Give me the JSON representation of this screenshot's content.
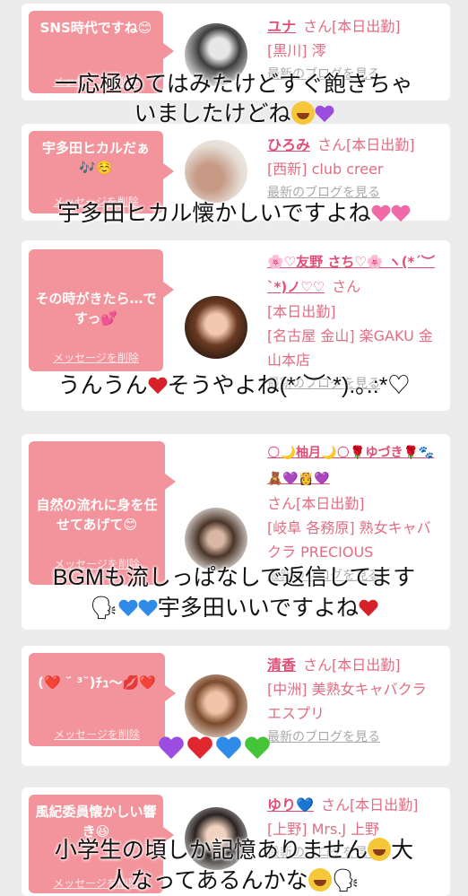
{
  "cards": [
    {
      "bubble_text": "SNS時代ですね😊",
      "delete_label": "メッセージを削除",
      "name": "ユナ",
      "status": "さん[本日出勤]",
      "area": "[黒川] 澪",
      "blog_link": "最新のブログを見る"
    },
    {
      "bubble_text": "宇多田ヒカルだぁ🎶☺️",
      "delete_label": "メッセージを削除",
      "name": "ひろみ",
      "status": "さん[本日出勤]",
      "area": "[西新] club creer",
      "blog_link": "最新のブログを見る"
    },
    {
      "bubble_text": "その時がきたら…ですっ💕",
      "delete_label": "メッセージを削除",
      "name": "🌸♡友野 さち♡🌸 ヽ(*´︶`*)ノ♡♡",
      "status": "さん",
      "status2": "[本日出勤]",
      "area": "[名古屋 金山] 楽GAKU 金山本店",
      "blog_link": "最新のブログを見る"
    },
    {
      "bubble_text": "自然の流れに身を任せてあげて😊",
      "delete_label": "メッセージを削除",
      "name": "🌕🌙柚月🌙🌕🌹ゆづき🌹🐾🧸💜👸💜",
      "status": "さん[本日出勤]",
      "area": "[岐阜 各務原] 熟女キャバクラ PRECIOUS",
      "blog_link": "最新のブログを見る"
    },
    {
      "bubble_text": "(❤️ ˘ ³˘)ﾁｭ〜💋❤️",
      "delete_label": "メッセージを削除",
      "name": "清香",
      "status": "さん[本日出勤]",
      "area": "[中洲] 美熟女キャバクラ エスプリ",
      "blog_link": "最新のブログを見る"
    },
    {
      "bubble_text": "風紀委員懐かしい響き😆",
      "delete_label": "メッセージを削除",
      "name": "ゆり💙",
      "status": "さん[本日出勤]",
      "area": "[上野] Mrs.J 上野",
      "blog_link": "最新のブログを見る"
    }
  ],
  "overlays": {
    "o1_line1": "一応極めてはみたけどすぐ飽きちゃ",
    "o1_line2": "いましたけどね",
    "o2": "宇多田ヒカル懐かしいですよね",
    "o3": "うんうん",
    "o3b": "そうやよね(*´︶`*).｡.:*♡",
    "o4_line1": "BGMも流しっぱなしで返信してます",
    "o4_line2": "宇多田いいですよね",
    "o6_line1": "小学生の頃しか記憶ありません",
    "o6_line1b": "大",
    "o6_line2": "人なってあるんかな"
  },
  "colors": {
    "bubble": "#f3939b",
    "name": "#e24d76",
    "info": "#e06d83",
    "blog": "#a9a9a9"
  }
}
